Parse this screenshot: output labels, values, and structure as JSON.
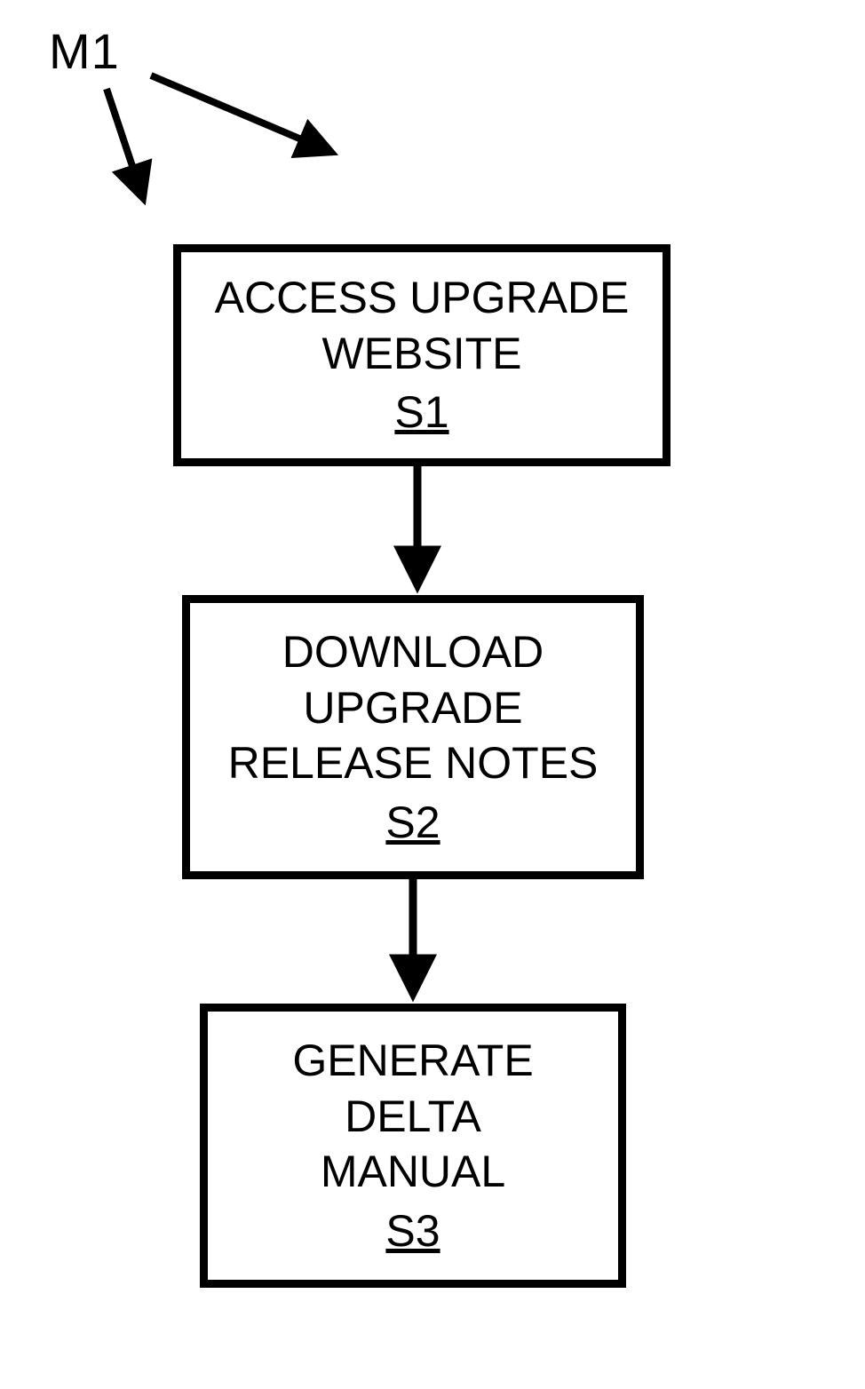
{
  "label": {
    "m1": "M1"
  },
  "steps": {
    "s1": {
      "line1": "ACCESS UPGRADE",
      "line2": "WEBSITE",
      "ref": "S1"
    },
    "s2": {
      "line1": "DOWNLOAD",
      "line2": "UPGRADE",
      "line3": "RELEASE NOTES",
      "ref": "S2"
    },
    "s3": {
      "line1": "GENERATE",
      "line2": "DELTA",
      "line3": "MANUAL",
      "ref": "S3"
    }
  }
}
